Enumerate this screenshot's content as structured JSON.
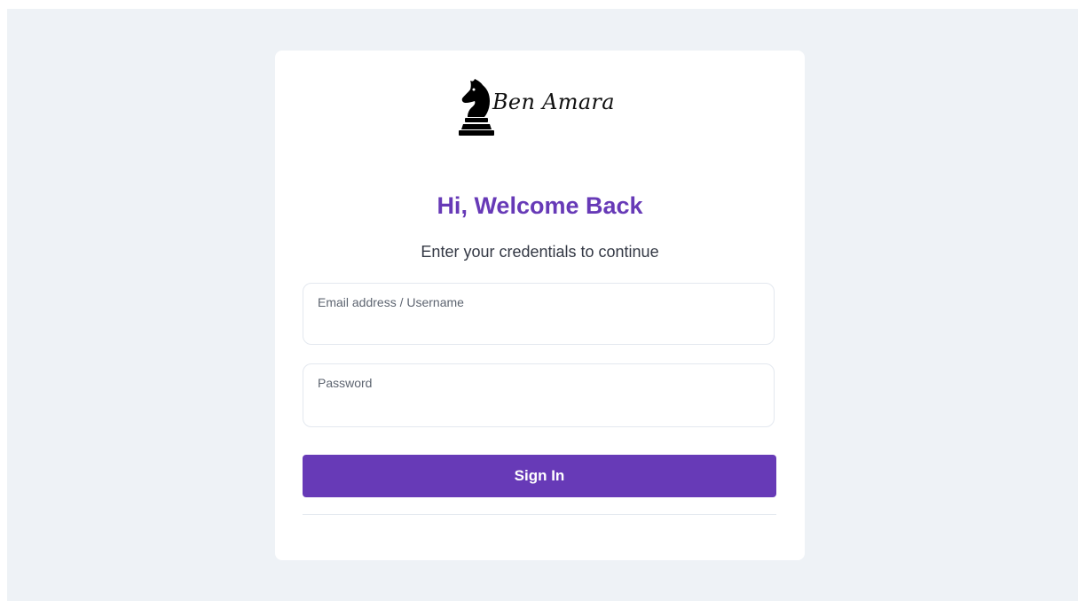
{
  "logo": {
    "text": "Ben Amara",
    "icon": "chess-knight-icon"
  },
  "header": {
    "title": "Hi, Welcome Back",
    "subtitle": "Enter your credentials to continue"
  },
  "form": {
    "email": {
      "label": "Email address / Username",
      "value": ""
    },
    "password": {
      "label": "Password",
      "value": ""
    },
    "submit_label": "Sign In"
  },
  "colors": {
    "accent": "#673ab7",
    "background": "#eef2f6",
    "card": "#ffffff",
    "border": "#e3e8ef"
  }
}
